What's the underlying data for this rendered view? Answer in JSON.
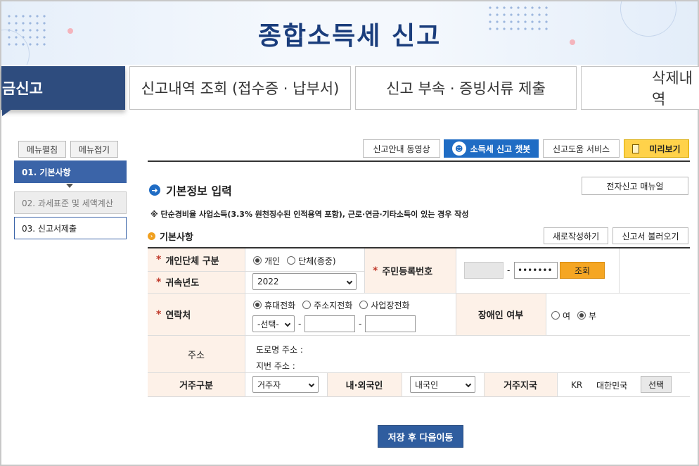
{
  "page_title": "종합소득세 신고",
  "tabs": [
    {
      "label": "금신고"
    },
    {
      "label": "신고내역 조회 (접수증 · 납부서)"
    },
    {
      "label": "신고 부속 · 증빙서류 제출"
    },
    {
      "label": "삭제내역"
    }
  ],
  "sidebar": {
    "expand_label": "메뉴펼침",
    "collapse_label": "메뉴접기",
    "steps": [
      {
        "label": "01. 기본사항"
      },
      {
        "label": "02. 과세표준 및 세액계산"
      },
      {
        "label": "03. 신고서제출"
      }
    ]
  },
  "toolbar": {
    "guide_video": "신고안내 동영상",
    "chatbot": "소득세 신고 챗봇",
    "help_service": "신고도움 서비스",
    "preview": "미리보기"
  },
  "section": {
    "title": "기본정보 입력",
    "manual_button": "전자신고 매뉴얼",
    "notice": "※ 단순경비율 사업소득(3.3% 원천징수된 인적용역 포함), 근로·연금·기타소득이 있는 경우 작성",
    "subtitle": "기본사항",
    "new_button": "새로작성하기",
    "load_button": "신고서 불러오기"
  },
  "form": {
    "entity_type": {
      "label": "개인단체 구분",
      "options": [
        "개인",
        "단체(종중)"
      ],
      "selected": "개인"
    },
    "year": {
      "label": "귀속년도",
      "value": "2022"
    },
    "resident_no": {
      "label": "주민등록번호",
      "masked": "•••••••",
      "query_button": "조회",
      "dash": "-"
    },
    "contact": {
      "label": "연락처",
      "options": [
        "휴대전화",
        "주소지전화",
        "사업장전화"
      ],
      "selected": "휴대전화",
      "prefix_value": "-선택-",
      "dash": "-"
    },
    "disabled": {
      "label": "장애인 여부",
      "options": [
        "여",
        "부"
      ],
      "selected": "부"
    },
    "address": {
      "label": "주소",
      "road": "도로명 주소 :",
      "lot": "지번 주소 :"
    },
    "residence": {
      "label": "거주구분",
      "value": "거주자"
    },
    "nationality": {
      "label": "내·외국인",
      "value": "내국인"
    },
    "country": {
      "label": "거주지국",
      "code": "KR",
      "name": "대한민국",
      "select_button": "선택"
    }
  },
  "save_button": "저장 후 다음이동",
  "colors": {
    "brand_navy": "#2e4c7e",
    "primary_blue": "#1f6cc4",
    "accent_orange": "#f5a623",
    "label_bg": "#fdf1e8"
  }
}
